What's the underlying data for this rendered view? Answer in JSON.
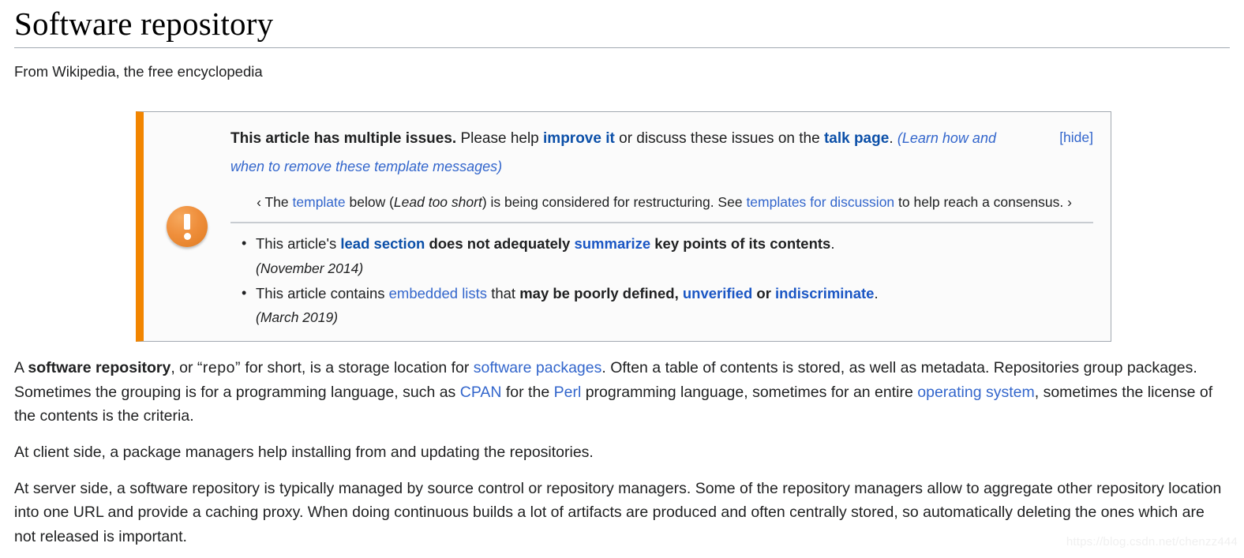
{
  "article": {
    "title": "Software repository",
    "tagline": "From Wikipedia, the free encyclopedia"
  },
  "ambox": {
    "head_bold": "This article has multiple issues.",
    "head_text_1": " Please help ",
    "head_link_improve": "improve it",
    "head_text_2": " or discuss these issues on the ",
    "head_link_talk": "talk page",
    "head_text_3": ". ",
    "head_learn_more": "(Learn how and when to remove these template messages)",
    "hide_label": "[hide]",
    "subnotice": {
      "open_guillemet": "‹",
      "text_1": " The ",
      "link_template": "template",
      "text_2": " below (",
      "italic_lead": "Lead too short",
      "text_3": ") is being considered for restructuring. See ",
      "link_tfd": "templates for discussion",
      "text_4": " to help reach a consensus. ",
      "close_guillemet": "›"
    },
    "issues": [
      {
        "text_1": "This article's ",
        "link_1": "lead section",
        "text_2": " does not adequately ",
        "link_2": "summarize",
        "text_3": " key points of its contents",
        "text_4": ".",
        "date": "(November 2014)"
      },
      {
        "text_1": "This article contains ",
        "link_1": "embedded lists",
        "text_2": " that ",
        "bold_1": "may be poorly defined",
        "text_3": ", ",
        "link_2": "unverified",
        "text_4": " or ",
        "link_3": "indiscriminate",
        "text_5": ".",
        "date": "(March 2019)"
      }
    ],
    "icon": "exclamation-circle-icon",
    "colors": {
      "border_left": "#f28500",
      "border": "#a2a9b1",
      "background": "#fbfbfb",
      "link": "#3366cc"
    }
  },
  "paragraphs": {
    "p1": {
      "t1": "A ",
      "b1": "software repository",
      "t2": ", or ",
      "q1": "“repo”",
      "t3": " for short, is a storage location for ",
      "l1": "software packages",
      "t4": ". Often a table of contents is stored, as well as metadata. Repositories group packages. Sometimes the grouping is for a programming language, such as ",
      "l2": "CPAN",
      "t5": " for the ",
      "l3": "Perl",
      "t6": " programming language, sometimes for an entire ",
      "l4": "operating system",
      "t7": ", sometimes the license of the contents is the criteria."
    },
    "p2": "At client side, a package managers help installing from and updating the repositories.",
    "p3": "At server side, a software repository is typically managed by source control or repository managers. Some of the repository managers allow to aggregate other repository location into one URL and provide a caching proxy. When doing continuous builds a lot of artifacts are produced and often centrally stored, so automatically deleting the ones which are not released is important."
  },
  "watermark": "https://blog.csdn.net/chenzz444"
}
